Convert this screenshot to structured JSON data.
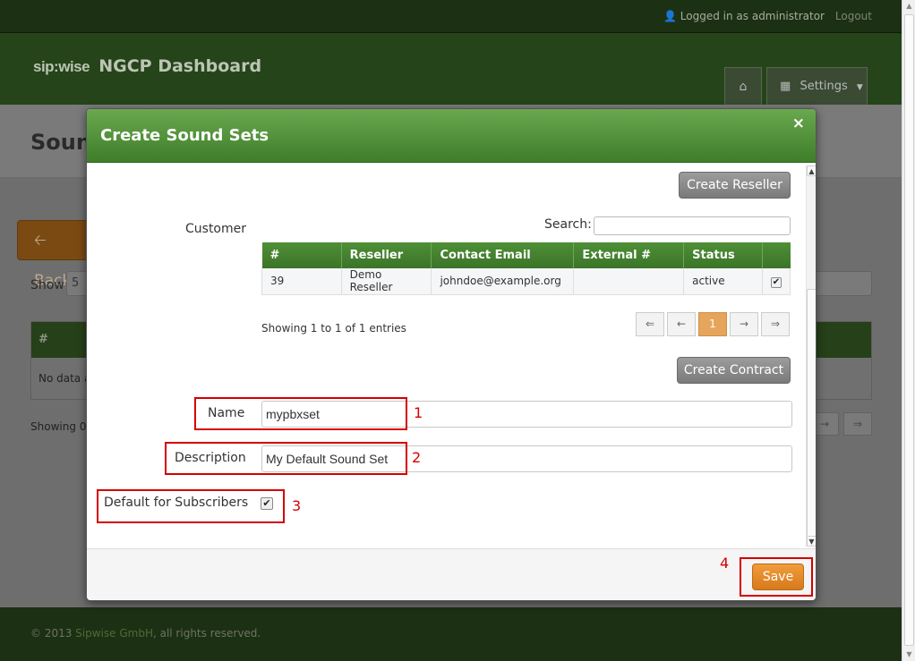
{
  "topbar": {
    "user_text": "Logged in as administrator",
    "logout": "Logout"
  },
  "header": {
    "logo": "sip:wise",
    "title": "NGCP Dashboard",
    "settings": "Settings"
  },
  "page": {
    "title": "Soun",
    "back": "Back",
    "show": "Show",
    "show_value": "5",
    "table_hash": "#",
    "no_data": "No data a",
    "showing": "Showing 0",
    "pagination": [
      "→",
      "⇒"
    ]
  },
  "modal": {
    "title": "Create Sound Sets",
    "close": "×",
    "create_reseller": "Create Reseller",
    "customer_label": "Customer",
    "search_label": "Search:",
    "search_value": "",
    "table": {
      "headers": [
        "#",
        "Reseller",
        "Contact Email",
        "External #",
        "Status",
        ""
      ],
      "rows": [
        {
          "id": "39",
          "reseller": "Demo Reseller",
          "email": "johndoe@example.org",
          "external": "",
          "status": "active",
          "selected": true
        }
      ]
    },
    "showing": "Showing 1 to 1 of 1 entries",
    "pagination": [
      "⇐",
      "←",
      "1",
      "→",
      "⇒"
    ],
    "create_contract": "Create Contract",
    "name_label": "Name",
    "name_value": "mypbxset",
    "description_label": "Description",
    "description_value": "My Default Sound Set",
    "default_label": "Default for Subscribers",
    "default_checked": true,
    "save": "Save"
  },
  "annotations": [
    "1",
    "2",
    "3",
    "4"
  ],
  "footer": {
    "copy_prefix": "© 2013 ",
    "company": "Sipwise GmbH",
    "copy_suffix": ", all rights reserved."
  },
  "colors": {
    "accent_green": "#4f8f37",
    "save_orange": "#e08a2c",
    "annotation_red": "#d40000"
  }
}
